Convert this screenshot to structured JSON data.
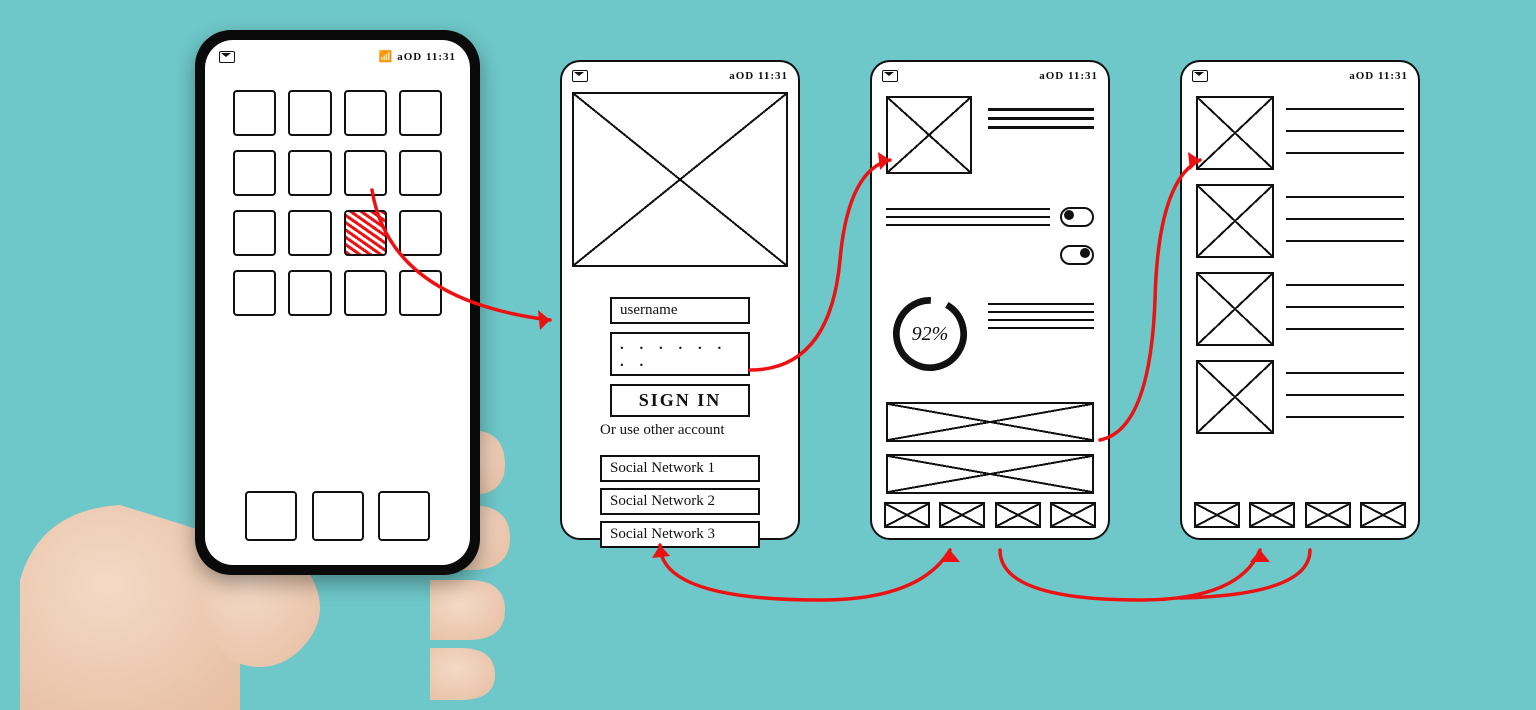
{
  "status": {
    "time": "11:31",
    "signal": "aOD"
  },
  "screen1": {
    "apps_rows": 4,
    "apps_cols": 4,
    "selected_index": 10,
    "dock_count": 3
  },
  "screen2": {
    "username_placeholder": "username",
    "password_mask": ". . . . . . . .",
    "signin_label": "SIGN IN",
    "alt_label": "Or use other account",
    "alt_options": [
      "Social Network 1",
      "Social Network 2",
      "Social Network 3"
    ]
  },
  "screen3": {
    "progress_label": "92%",
    "progress_value": 92,
    "tab_count": 4
  },
  "screen4": {
    "rows": 4,
    "tab_count": 4
  },
  "flow": [
    "home→login",
    "login→dashboard",
    "dashboard→list",
    "list⇄dashboard⇄login"
  ]
}
